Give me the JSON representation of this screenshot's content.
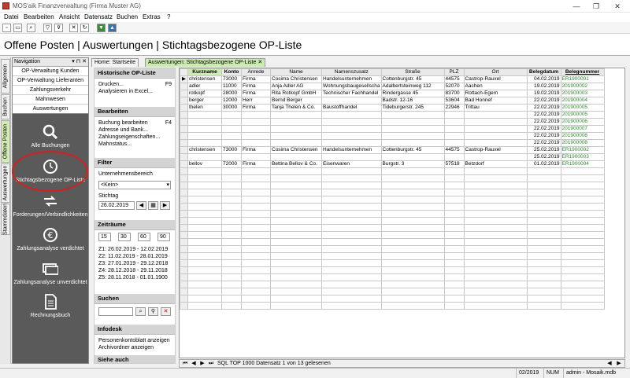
{
  "window": {
    "title": "MOS'aik Finanzverwaltung (Firma Muster AG)",
    "minimize": "—",
    "maximize": "❐",
    "close": "✕"
  },
  "menu": [
    "Datei",
    "Bearbeiten",
    "Ansicht",
    "Datensatz",
    "Buchen",
    "Extras",
    "?"
  ],
  "page_title": "Offene Posten | Auswertungen | Stichtagsbezogene OP-Liste",
  "vtabs": [
    "Allgemein",
    "Buchen",
    "Offene Posten",
    "Auswertungen",
    "Stammdaten"
  ],
  "navigation": {
    "header": "Navigation",
    "pins": "▾ ⊓ ✕",
    "items": [
      "OP-Verwaltung Kunden",
      "OP-Verwaltung Lieferanten",
      "Zahlungsverkehr",
      "Mahnwesen",
      "Auswertungen"
    ],
    "big_items": [
      "Alle Buchungen",
      "Stichtagsbezogene OP-Liste",
      "Forderungen/Verbindlichkeiten",
      "Zahlungsanalyse verdichtet",
      "Zahlungsanalyse unverdichtet",
      "Rechnungsbuch"
    ]
  },
  "tabs": [
    "Home: Startseite",
    "Auswertungen: Stichtagsbezogene OP-Liste"
  ],
  "pane": {
    "historisch": {
      "title": "Historische OP-Liste",
      "items": [
        {
          "label": "Drucken...",
          "key": "F9"
        },
        {
          "label": "Analysieren in Excel...",
          "key": ""
        }
      ]
    },
    "bearbeiten": {
      "title": "Bearbeiten",
      "items": [
        {
          "label": "Buchung bearbeiten",
          "key": "F4"
        },
        {
          "label": "Adresse und Bank...",
          "key": ""
        },
        {
          "label": "Zahlungseigenschaften...",
          "key": ""
        },
        {
          "label": "Mahnstatus...",
          "key": ""
        }
      ]
    },
    "filter": {
      "title": "Filter",
      "bereich_label": "Unternehmensbereich",
      "bereich_value": "<Kein>",
      "stichtag_label": "Stichtag",
      "stichtag_value": "26.02.2019"
    },
    "zeitraeume": {
      "title": "Zeiträume",
      "days": [
        "15",
        "30",
        "60",
        "90"
      ],
      "ranges": [
        "Z1:  26.02.2019 - 12.02.2019",
        "Z2:  11.02.2019 - 28.01.2019",
        "Z3:  27.01.2019 - 29.12.2018",
        "Z4:  28.12.2018 - 29.11.2018",
        "Z5:  28.11.2018 - 01.01.1900"
      ]
    },
    "suchen": {
      "title": "Suchen"
    },
    "infodesk": {
      "title": "Infodesk",
      "items": [
        "Personenkontoblatt anzeigen",
        "Archivordner anzeigen"
      ]
    },
    "siehe": {
      "title": "Siehe auch"
    }
  },
  "grid": {
    "columns": [
      "Kurzname",
      "Konto",
      "Anrede",
      "Name",
      "Namenszusatz",
      "Straße",
      "PLZ",
      "Ort",
      "Belegdatum",
      "Belegnummer"
    ],
    "rows": [
      {
        "kurz": "christensen",
        "konto": "73000",
        "anrede": "Firma",
        "name": "Cosima Christensen",
        "zusatz": "Handelsunternehmen",
        "strasse": "Cottenburgstr. 45",
        "plz": "44575",
        "ort": "Castrop-Rauxel",
        "datum": "04.02.2019",
        "beleg": "ER1900001"
      },
      {
        "kurz": "adler",
        "konto": "11000",
        "anrede": "Firma",
        "name": "Anja Adler AG",
        "zusatz": "Wohnungsbaugesellscha",
        "strasse": "Adalbertsteinweg 112",
        "plz": "52070",
        "ort": "Aachen",
        "datum": "19.02.2019",
        "beleg": "201900002"
      },
      {
        "kurz": "rotkopf",
        "konto": "28000",
        "anrede": "Firma",
        "name": "Rita Rotkopf GmbH",
        "zusatz": "Technischer Fachhandel",
        "strasse": "Rindergasse 45",
        "plz": "83700",
        "ort": "Rottach-Egern",
        "datum": "19.02.2019",
        "beleg": "201900003"
      },
      {
        "kurz": "berger",
        "konto": "12000",
        "anrede": "Herr",
        "name": "Bernd Berger",
        "zusatz": "",
        "strasse": "Badstr. 12-16",
        "plz": "53604",
        "ort": "Bad Honnef",
        "datum": "22.02.2019",
        "beleg": "201900004"
      },
      {
        "kurz": "thelen",
        "konto": "30000",
        "anrede": "Firma",
        "name": "Tanja Thelen & Co.",
        "zusatz": "Baustoffhandel",
        "strasse": "Tideburgerstr. 245",
        "plz": "22946",
        "ort": "Trittau",
        "datum": "22.02.2019",
        "beleg": "201900005"
      },
      {
        "kurz": "",
        "konto": "",
        "anrede": "",
        "name": "",
        "zusatz": "",
        "strasse": "",
        "plz": "",
        "ort": "",
        "datum": "22.02.2019",
        "beleg": "201900005"
      },
      {
        "kurz": "",
        "konto": "",
        "anrede": "",
        "name": "",
        "zusatz": "",
        "strasse": "",
        "plz": "",
        "ort": "",
        "datum": "22.02.2019",
        "beleg": "201900006"
      },
      {
        "kurz": "",
        "konto": "",
        "anrede": "",
        "name": "",
        "zusatz": "",
        "strasse": "",
        "plz": "",
        "ort": "",
        "datum": "22.02.2019",
        "beleg": "201900007"
      },
      {
        "kurz": "",
        "konto": "",
        "anrede": "",
        "name": "",
        "zusatz": "",
        "strasse": "",
        "plz": "",
        "ort": "",
        "datum": "22.02.2019",
        "beleg": "201900008"
      },
      {
        "kurz": "",
        "konto": "",
        "anrede": "",
        "name": "",
        "zusatz": "",
        "strasse": "",
        "plz": "",
        "ort": "",
        "datum": "22.02.2019",
        "beleg": "201900008"
      },
      {
        "kurz": "christensen",
        "konto": "73000",
        "anrede": "Firma",
        "name": "Cosima Christensen",
        "zusatz": "Handelsunternehmen",
        "strasse": "Cottenburgstr. 45",
        "plz": "44575",
        "ort": "Castrop-Rauxel",
        "datum": "25.02.2019",
        "beleg": "ER1900002"
      },
      {
        "kurz": "",
        "konto": "",
        "anrede": "",
        "name": "",
        "zusatz": "",
        "strasse": "",
        "plz": "",
        "ort": "",
        "datum": "25.02.2019",
        "beleg": "ER1900003"
      },
      {
        "kurz": "bellov",
        "konto": "72000",
        "anrede": "Firma",
        "name": "Bettina Bellov & Co.",
        "zusatz": "Eisenwaren",
        "strasse": "Burgstr. 3",
        "plz": "57518",
        "ort": "Betzdorf",
        "datum": "01.02.2019",
        "beleg": "ER1900004"
      }
    ],
    "footer": "SQL TOP 1000 Datensatz 1 von 13 gelesenen"
  },
  "status": {
    "period": "02/2019",
    "num": "NUM",
    "user": "admin - Mosaik.mdb"
  },
  "colors": {
    "accent_green": "#ccebb0",
    "link_green": "#2e8b2e",
    "highlight_red": "#d62020",
    "nav_dark": "#5a5a5a"
  }
}
